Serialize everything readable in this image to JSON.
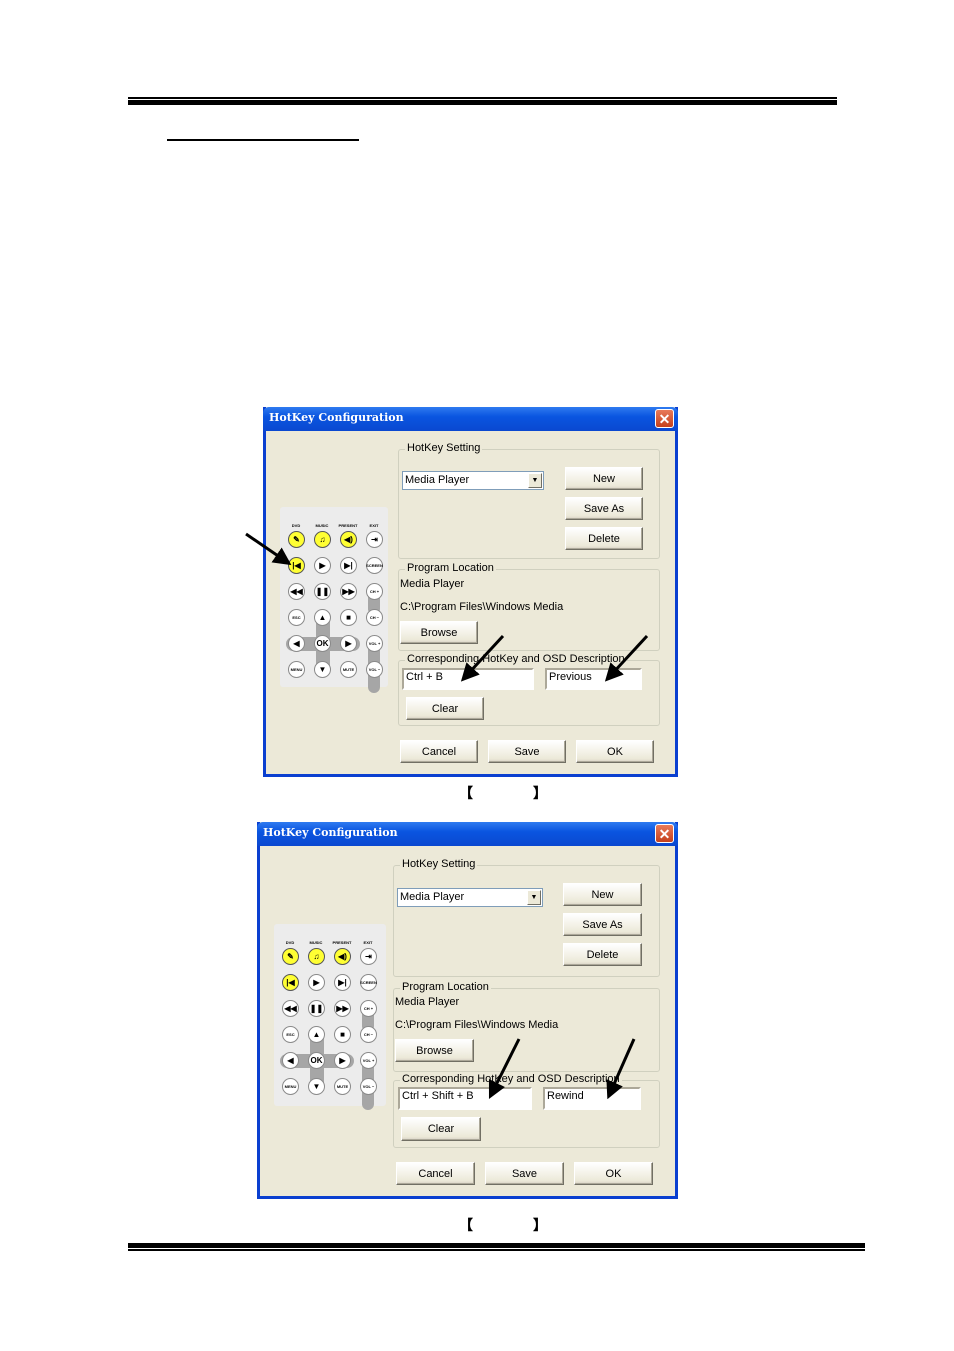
{
  "document": {
    "captions": [
      {
        "open": "【",
        "label": "",
        "close": "】"
      },
      {
        "open": "【",
        "label": "",
        "close": "】"
      }
    ]
  },
  "dialogs": [
    {
      "title": "HotKey Configuration",
      "close_label": "✕",
      "hotkey_setting": {
        "legend": "HotKey Setting",
        "program_select": "Media Player",
        "new_label": "New",
        "save_as_label": "Save As",
        "delete_label": "Delete"
      },
      "program_location": {
        "legend": "Program Location",
        "name": "Media Player",
        "path": "C:\\Program Files\\Windows Media",
        "browse_label": "Browse"
      },
      "hotkey_osd": {
        "legend": "Corresponding HotKey and OSD Description",
        "hotkey_value": "Ctrl + B",
        "osd_value": "Previous",
        "clear_label": "Clear"
      },
      "footer": {
        "cancel_label": "Cancel",
        "save_label": "Save",
        "ok_label": "OK"
      },
      "highlighted_remote_button": "previous"
    },
    {
      "title": "HotKey Configuration",
      "close_label": "✕",
      "hotkey_setting": {
        "legend": "HotKey Setting",
        "program_select": "Media Player",
        "new_label": "New",
        "save_as_label": "Save As",
        "delete_label": "Delete"
      },
      "program_location": {
        "legend": "Program Location",
        "name": "Media Player",
        "path": "C:\\Program Files\\Windows Media",
        "browse_label": "Browse"
      },
      "hotkey_osd": {
        "legend": "Corresponding HotKey and OSD Description",
        "hotkey_value": "Ctrl + Shift + B",
        "osd_value": "Rewind",
        "clear_label": "Clear"
      },
      "footer": {
        "cancel_label": "Cancel",
        "save_label": "Save",
        "ok_label": "OK"
      },
      "highlighted_remote_button": "previous"
    }
  ],
  "remote": {
    "top_labels": [
      "DVD",
      "MUSIC",
      "PRESENT",
      "EXIT"
    ],
    "rows": [
      [
        {
          "id": "dvd",
          "glyph": "✎",
          "yellow": true
        },
        {
          "id": "music",
          "glyph": "♫",
          "yellow": true
        },
        {
          "id": "present",
          "glyph": "◀)",
          "yellow": true
        },
        {
          "id": "exit",
          "glyph": "⇥",
          "yellow": false
        }
      ],
      [
        {
          "id": "previous",
          "glyph": "|◀",
          "yellow": true
        },
        {
          "id": "play",
          "glyph": "▶",
          "yellow": false
        },
        {
          "id": "next",
          "glyph": "▶|",
          "yellow": false
        },
        {
          "id": "screen",
          "glyph": "SCREEN",
          "yellow": false,
          "tiny": true
        }
      ],
      [
        {
          "id": "rewind",
          "glyph": "◀◀",
          "yellow": false
        },
        {
          "id": "pause",
          "glyph": "❚❚",
          "yellow": false
        },
        {
          "id": "forward",
          "glyph": "▶▶",
          "yellow": false
        },
        {
          "id": "ch-up",
          "glyph": "CH +",
          "yellow": false,
          "tiny": true
        }
      ],
      [
        {
          "id": "esc",
          "glyph": "ESC",
          "yellow": false,
          "tiny": true
        },
        {
          "id": "up",
          "glyph": "▲",
          "yellow": false
        },
        {
          "id": "stop",
          "glyph": "■",
          "yellow": false
        },
        {
          "id": "ch-down",
          "glyph": "CH −",
          "yellow": false,
          "tiny": true
        }
      ],
      [
        {
          "id": "left",
          "glyph": "◀",
          "yellow": false
        },
        {
          "id": "ok",
          "glyph": "OK",
          "yellow": false
        },
        {
          "id": "right",
          "glyph": "▶",
          "yellow": false
        },
        {
          "id": "vol-up",
          "glyph": "VOL +",
          "yellow": false,
          "tiny": true
        }
      ],
      [
        {
          "id": "menu",
          "glyph": "MENU",
          "yellow": false,
          "tiny": true
        },
        {
          "id": "down",
          "glyph": "▼",
          "yellow": false
        },
        {
          "id": "mute",
          "glyph": "MUTE",
          "yellow": false,
          "tiny": true
        },
        {
          "id": "vol-down",
          "glyph": "VOL −",
          "yellow": false,
          "tiny": true
        }
      ]
    ]
  },
  "colors": {
    "dialog_face": "#ece9d8",
    "title_blue": "#0a55e0",
    "remote_yellow": "#ffff33"
  }
}
